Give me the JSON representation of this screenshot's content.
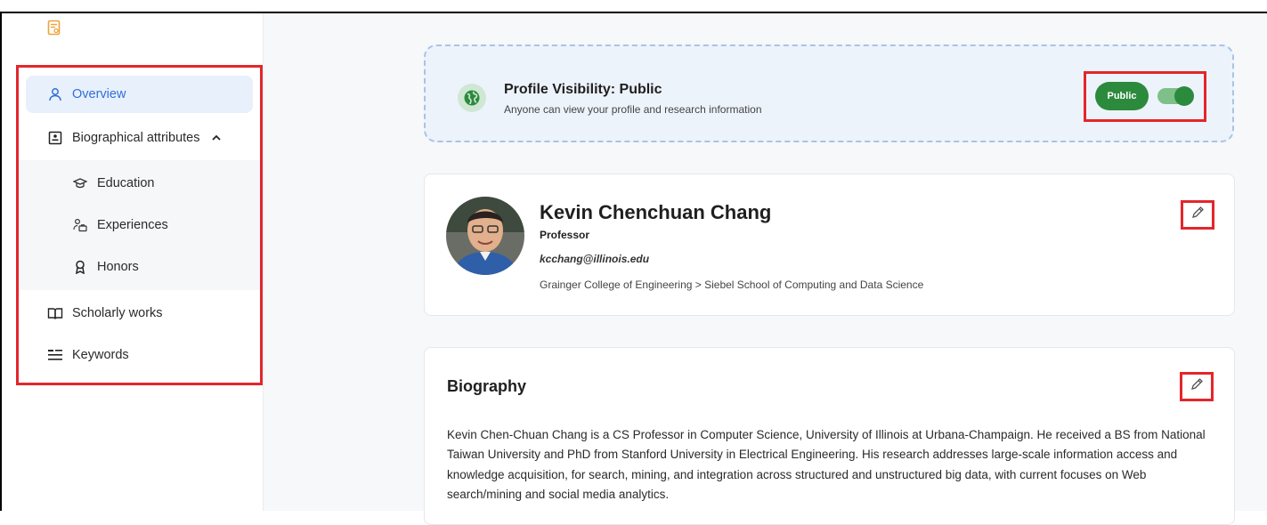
{
  "sidebar": {
    "items": [
      {
        "label": "Overview",
        "icon": "user-icon",
        "active": true
      },
      {
        "label": "Biographical attributes",
        "icon": "id-card-icon",
        "expanded": true
      },
      {
        "label": "Education",
        "icon": "graduation-cap-icon"
      },
      {
        "label": "Experiences",
        "icon": "people-briefcase-icon"
      },
      {
        "label": "Honors",
        "icon": "award-icon"
      },
      {
        "label": "Scholarly works",
        "icon": "open-book-icon"
      },
      {
        "label": "Keywords",
        "icon": "list-icon"
      }
    ]
  },
  "visibility": {
    "title": "Profile Visibility: Public",
    "subtitle": "Anyone can view your profile and research information",
    "badge": "Public",
    "enabled": true
  },
  "profile": {
    "name": "Kevin Chenchuan Chang",
    "role": "Professor",
    "email": "kcchang@illinois.edu",
    "affiliation": "Grainger College of Engineering > Siebel School of Computing and Data Science"
  },
  "biography": {
    "title": "Biography",
    "text": "Kevin Chen-Chuan Chang is a CS Professor in Computer Science, University of Illinois at Urbana-Champaign. He received a BS from National Taiwan University and PhD from Stanford University in Electrical Engineering. His research addresses large-scale information access and knowledge acquisition, for search, mining, and integration across structured and unstructured big data, with current focuses on Web search/mining and social media analytics."
  },
  "colors": {
    "accent": "#2f6fd8",
    "public_green": "#2c8a3d",
    "highlight_red": "#e3262b",
    "logo_orange": "#f0a23a"
  }
}
